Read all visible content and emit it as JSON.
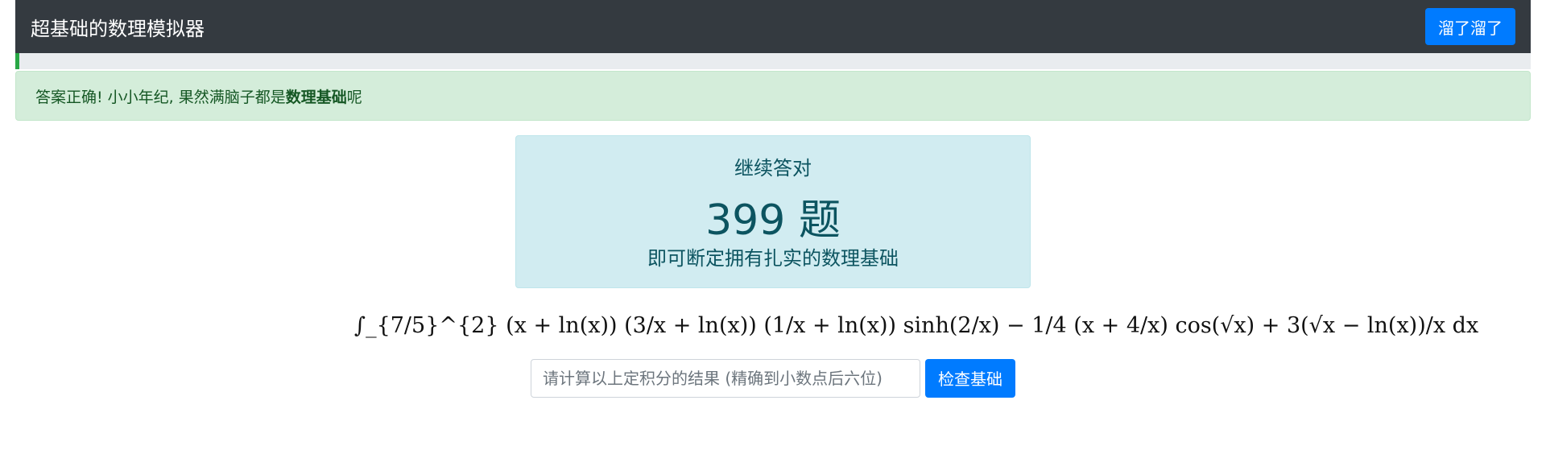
{
  "navbar": {
    "brand": "超基础的数理模拟器",
    "button_label": "溜了溜了"
  },
  "progress": {
    "fraction": 0.0025,
    "color": "#28a745"
  },
  "alert": {
    "text_before": "答案正确! 小小年纪, 果然满脑子都是",
    "bold": "数理基础",
    "text_after": "呢"
  },
  "info": {
    "line1": "继续答对",
    "count": "399 题",
    "line3": "即可断定拥有扎实的数理基础"
  },
  "formula": {
    "text": "∫_{7/5}^{2} (x + ln(x)) (3/x + ln(x)) (1/x + ln(x)) sinh(2/x) − 1/4 (x + 4/x) cos(√x) + 3(√x − ln(x))/x dx"
  },
  "answer": {
    "value": "",
    "placeholder": "请计算以上定积分的结果 (精确到小数点后六位)",
    "button_label": "检查基础"
  },
  "colors": {
    "navbar_bg": "#343a40",
    "primary": "#007bff",
    "success_bg": "#d4edda",
    "info_bg": "#d1ecf1"
  }
}
